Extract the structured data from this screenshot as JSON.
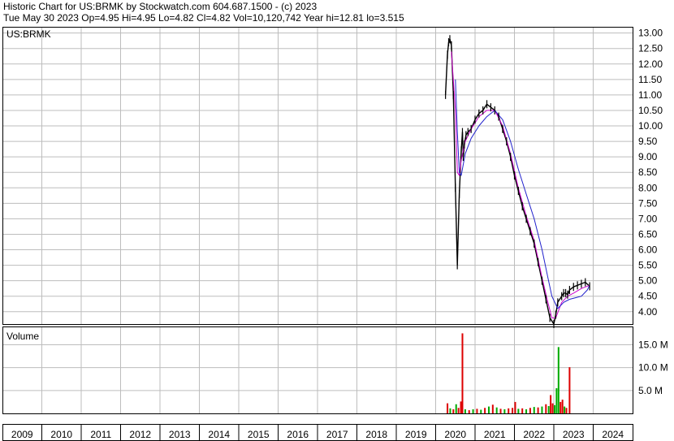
{
  "header": {
    "line1": "Historic Chart for US:BRMK by Stockwatch.com 604.687.1500 - (c) 2023",
    "line2": "Tue May 30 2023   Op=4.95   Hi=4.95   Lo=4.82   Cl=4.82   Vol=10,120,742   Year hi=12.81   lo=3.515"
  },
  "chart_data": [
    {
      "type": "line",
      "title": "US:BRMK",
      "ylim": [
        3.6,
        13.2
      ],
      "y_ticks": [
        "13.00",
        "12.50",
        "12.00",
        "11.50",
        "11.00",
        "10.50",
        "10.00",
        "9.50",
        "9.00",
        "8.50",
        "8.00",
        "7.50",
        "7.00",
        "6.50",
        "6.00",
        "5.50",
        "5.00",
        "4.50",
        "4.00"
      ],
      "x_labels": [
        "2009",
        "2010",
        "2011",
        "2012",
        "2013",
        "2014",
        "2015",
        "2016",
        "2017",
        "2018",
        "2019",
        "2020",
        "2021",
        "2022",
        "2023",
        "2024"
      ],
      "grid": true,
      "series": [
        {
          "kind": "price",
          "color": "#000000",
          "x": [
            2019.75,
            2019.8,
            2019.83,
            2019.86,
            2019.9,
            2019.95,
            2020.0,
            2020.05,
            2020.1,
            2020.15,
            2020.18,
            2020.2,
            2020.23,
            2020.27,
            2020.32,
            2020.4,
            2020.5,
            2020.6,
            2020.7,
            2020.8,
            2020.9,
            2021.0,
            2021.1,
            2021.2,
            2021.3,
            2021.4,
            2021.5,
            2021.6,
            2021.7,
            2021.8,
            2021.9,
            2022.0,
            2022.1,
            2022.2,
            2022.3,
            2022.4,
            2022.5,
            2022.55,
            2022.6,
            2022.7,
            2022.75,
            2022.8,
            2022.85,
            2022.9,
            2023.0,
            2023.1,
            2023.2,
            2023.3,
            2023.41
          ],
          "values": [
            11.0,
            12.3,
            12.7,
            12.8,
            12.6,
            11.0,
            8.0,
            5.5,
            7.8,
            9.2,
            9.8,
            9.0,
            9.4,
            9.7,
            9.8,
            9.9,
            10.2,
            10.4,
            10.5,
            10.7,
            10.6,
            10.5,
            10.3,
            9.9,
            9.5,
            9.0,
            8.4,
            7.9,
            7.4,
            7.0,
            6.6,
            6.2,
            5.6,
            5.0,
            4.4,
            3.8,
            3.6,
            3.9,
            4.3,
            4.5,
            4.6,
            4.6,
            4.55,
            4.7,
            4.8,
            4.85,
            4.9,
            4.95,
            4.82
          ]
        },
        {
          "kind": "short moving average",
          "color": "#cc00cc",
          "x": [
            2019.9,
            2020.0,
            2020.05,
            2020.1,
            2020.15,
            2020.25,
            2020.4,
            2020.6,
            2020.8,
            2021.0,
            2021.2,
            2021.4,
            2021.6,
            2021.8,
            2022.0,
            2022.2,
            2022.35,
            2022.45,
            2022.55,
            2022.7,
            2022.85,
            2023.0,
            2023.2,
            2023.41
          ],
          "values": [
            12.4,
            10.5,
            8.5,
            8.4,
            8.9,
            9.5,
            9.9,
            10.3,
            10.5,
            10.5,
            10.0,
            9.1,
            8.0,
            7.1,
            6.3,
            5.1,
            4.3,
            3.8,
            3.8,
            4.3,
            4.5,
            4.6,
            4.75,
            4.85
          ]
        },
        {
          "kind": "long moving average",
          "color": "#2020cc",
          "x": [
            2020.0,
            2020.05,
            2020.1,
            2020.15,
            2020.25,
            2020.4,
            2020.6,
            2020.8,
            2021.0,
            2021.2,
            2021.4,
            2021.6,
            2021.8,
            2022.0,
            2022.2,
            2022.35,
            2022.45,
            2022.6,
            2022.75,
            2022.9,
            2023.05,
            2023.2,
            2023.35,
            2023.41
          ],
          "values": [
            11.5,
            9.8,
            8.5,
            8.4,
            9.1,
            9.6,
            10.0,
            10.3,
            10.5,
            10.2,
            9.5,
            8.6,
            7.8,
            7.0,
            6.0,
            5.1,
            4.5,
            4.1,
            4.3,
            4.4,
            4.45,
            4.5,
            4.7,
            4.85
          ]
        }
      ]
    },
    {
      "type": "bar",
      "title": "Volume",
      "ylim": [
        0,
        19
      ],
      "y_ticks": [
        "15.0 M",
        "10.0 M",
        "5.0 M"
      ],
      "grid": true,
      "colors": {
        "up": "#00aa00",
        "down": "#dd0000"
      },
      "bars": [
        {
          "x": 2019.8,
          "value": 2.2,
          "dir": "down"
        },
        {
          "x": 2019.87,
          "value": 1.1,
          "dir": "up"
        },
        {
          "x": 2019.95,
          "value": 0.9,
          "dir": "down"
        },
        {
          "x": 2020.02,
          "value": 2.0,
          "dir": "up"
        },
        {
          "x": 2020.08,
          "value": 1.2,
          "dir": "down"
        },
        {
          "x": 2020.14,
          "value": 2.6,
          "dir": "down"
        },
        {
          "x": 2020.18,
          "value": 17.5,
          "dir": "down"
        },
        {
          "x": 2020.25,
          "value": 0.9,
          "dir": "up"
        },
        {
          "x": 2020.35,
          "value": 0.7,
          "dir": "down"
        },
        {
          "x": 2020.45,
          "value": 0.9,
          "dir": "up"
        },
        {
          "x": 2020.55,
          "value": 1.0,
          "dir": "down"
        },
        {
          "x": 2020.65,
          "value": 0.8,
          "dir": "up"
        },
        {
          "x": 2020.75,
          "value": 1.2,
          "dir": "down"
        },
        {
          "x": 2020.85,
          "value": 1.5,
          "dir": "up"
        },
        {
          "x": 2020.95,
          "value": 1.9,
          "dir": "down"
        },
        {
          "x": 2021.05,
          "value": 1.3,
          "dir": "up"
        },
        {
          "x": 2021.15,
          "value": 1.0,
          "dir": "down"
        },
        {
          "x": 2021.25,
          "value": 0.9,
          "dir": "up"
        },
        {
          "x": 2021.35,
          "value": 1.1,
          "dir": "down"
        },
        {
          "x": 2021.45,
          "value": 1.2,
          "dir": "down"
        },
        {
          "x": 2021.52,
          "value": 2.5,
          "dir": "down"
        },
        {
          "x": 2021.6,
          "value": 1.0,
          "dir": "up"
        },
        {
          "x": 2021.7,
          "value": 1.1,
          "dir": "down"
        },
        {
          "x": 2021.8,
          "value": 0.9,
          "dir": "up"
        },
        {
          "x": 2021.9,
          "value": 1.2,
          "dir": "down"
        },
        {
          "x": 2022.0,
          "value": 1.4,
          "dir": "up"
        },
        {
          "x": 2022.1,
          "value": 1.3,
          "dir": "down"
        },
        {
          "x": 2022.2,
          "value": 1.5,
          "dir": "up"
        },
        {
          "x": 2022.3,
          "value": 2.0,
          "dir": "down"
        },
        {
          "x": 2022.37,
          "value": 1.6,
          "dir": "up"
        },
        {
          "x": 2022.42,
          "value": 4.0,
          "dir": "down"
        },
        {
          "x": 2022.47,
          "value": 2.2,
          "dir": "down"
        },
        {
          "x": 2022.52,
          "value": 1.8,
          "dir": "up"
        },
        {
          "x": 2022.57,
          "value": 5.5,
          "dir": "up"
        },
        {
          "x": 2022.62,
          "value": 14.5,
          "dir": "up"
        },
        {
          "x": 2022.67,
          "value": 2.5,
          "dir": "down"
        },
        {
          "x": 2022.72,
          "value": 3.0,
          "dir": "down"
        },
        {
          "x": 2022.77,
          "value": 1.5,
          "dir": "up"
        },
        {
          "x": 2022.82,
          "value": 1.2,
          "dir": "down"
        },
        {
          "x": 2022.9,
          "value": 10.1,
          "dir": "down"
        }
      ]
    }
  ]
}
